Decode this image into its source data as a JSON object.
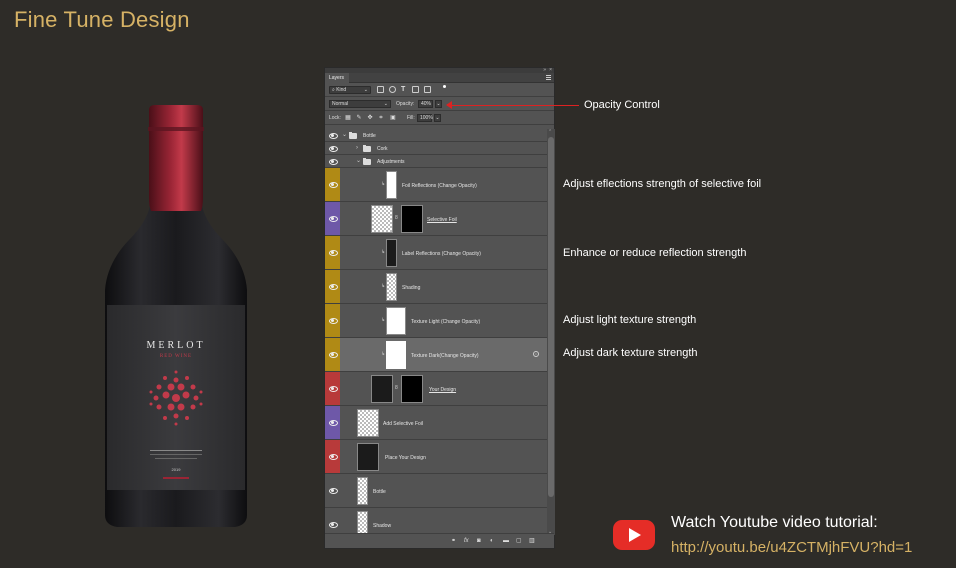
{
  "page": {
    "title": "Fine Tune Design"
  },
  "bottle": {
    "brand": "MERLOT",
    "subtitle": "RED WINE",
    "year": "2019"
  },
  "panel": {
    "tab": "Layers",
    "filter": {
      "kind_label": "Kind",
      "dropdown": "⌄"
    },
    "blend": {
      "mode": "Normal",
      "opacity_label": "Opacity:",
      "opacity_value": "40%"
    },
    "lock": {
      "label": "Lock:",
      "fill_label": "Fill:",
      "fill_value": "100%"
    },
    "layers": [
      {
        "name": "Bottle",
        "type": "group",
        "color": ""
      },
      {
        "name": "Cork",
        "type": "group",
        "color": ""
      },
      {
        "name": "Adjustments",
        "type": "group",
        "color": ""
      },
      {
        "name": "Foil Reflections (Change Opacity)",
        "type": "layer",
        "color": "#b08a15"
      },
      {
        "name": "Selective Foil",
        "type": "smart",
        "color": "#6e58a8"
      },
      {
        "name": "Label Reflections (Change Opacity)",
        "type": "layer",
        "color": "#b08a15"
      },
      {
        "name": "Shading",
        "type": "layer",
        "color": "#b08a15"
      },
      {
        "name": "Texture Light (Change Opacity)",
        "type": "layer",
        "color": "#b08a15"
      },
      {
        "name": "Texture Dark(Change Opacity)",
        "type": "layer",
        "color": "#b08a15"
      },
      {
        "name": "Your Design",
        "type": "smart",
        "color": "#b83a3a"
      },
      {
        "name": "Add Selective Foil",
        "type": "layer",
        "color": "#6e58a8"
      },
      {
        "name": "Place Your Design",
        "type": "layer",
        "color": "#b83a3a"
      },
      {
        "name": "Bottle",
        "type": "layer",
        "color": ""
      },
      {
        "name": "Shadow",
        "type": "layer",
        "color": ""
      }
    ],
    "footer_icons": [
      "link-icon",
      "fx-icon",
      "mask-icon",
      "adjustment-icon",
      "folder-icon",
      "new-layer-icon",
      "trash-icon"
    ]
  },
  "annotations": {
    "opacity": "Opacity Control",
    "foil": "Adjust eflections strength of selective foil",
    "reflection": "Enhance or reduce reflection strength",
    "light": "Adjust light texture strength",
    "dark": "Adjust dark texture strength"
  },
  "youtube": {
    "title": "Watch Youtube video tutorial:",
    "link": "http://youtu.be/u4ZCTMjhFVU?hd=1"
  },
  "colors": {
    "background": "#2e2c28",
    "accent": "#d6b265",
    "arrow": "#dd2222",
    "youtube_red": "#e52d27"
  }
}
